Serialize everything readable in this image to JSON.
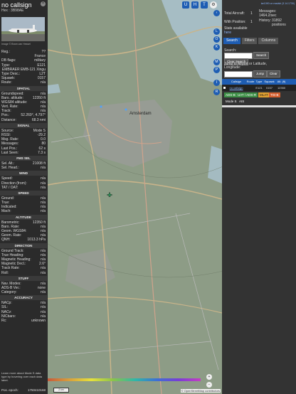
{
  "left": {
    "callsign": "no callsign",
    "hex_line": "Hex : 3B98AE",
    "photo_caption": "Image © Bram van Hessel",
    "info_rows": [
      {
        "k": "Reg.:",
        "v": "??"
      },
      {
        "k": "",
        "v": "France"
      },
      {
        "k": "DB flags:",
        "v": "military"
      },
      {
        "k": "Type:",
        "v": "E121"
      },
      {
        "k": "",
        "v": "EMBRAER EMB-121 Xingu"
      },
      {
        "k": "Type Desc.:",
        "v": "L2T"
      },
      {
        "k": "Squawk:",
        "v": "0157"
      },
      {
        "k": "Route:",
        "v": "n/a"
      }
    ],
    "sections": [
      {
        "title": "SPATIAL",
        "rows": [
          {
            "k": "Groundspeed:",
            "v": "n/a"
          },
          {
            "k": "Baro. altitude:",
            "v": "12350 ft"
          },
          {
            "k": "WGS84 altitude:",
            "v": "n/a"
          },
          {
            "k": "Vert. Rate:",
            "v": "n/a"
          },
          {
            "k": "Track:",
            "v": "n/a"
          },
          {
            "k": "Pos.:",
            "v": "52.269°, 4.797°"
          },
          {
            "k": "Distance:",
            "v": "68.3 nmi"
          }
        ]
      },
      {
        "title": "SIGNAL",
        "rows": [
          {
            "k": "Source:",
            "v": "Mode S"
          },
          {
            "k": "RSSI:",
            "v": "-29.2"
          },
          {
            "k": "Msg. Rate:",
            "v": "0.0"
          },
          {
            "k": "Messages:",
            "v": "80"
          },
          {
            "k": "Last Pos.:",
            "v": "62 s"
          },
          {
            "k": "Last Seen:",
            "v": "7.3 s"
          }
        ]
      },
      {
        "title": "FMS SEL",
        "rows": [
          {
            "k": "Sel. Alt.:",
            "v": "21008 ft"
          },
          {
            "k": "Sel. Head.:",
            "v": "n/a"
          }
        ]
      },
      {
        "title": "WIND",
        "rows": [
          {
            "k": "Speed:",
            "v": "n/a"
          },
          {
            "k": "Direction (from):",
            "v": "n/a"
          },
          {
            "k": "TAT / OAT:",
            "v": "n/a"
          }
        ]
      },
      {
        "title": "SPEED",
        "rows": [
          {
            "k": "Ground:",
            "v": "n/a"
          },
          {
            "k": "True:",
            "v": "n/a"
          },
          {
            "k": "Indicated:",
            "v": "n/a"
          },
          {
            "k": "Mach:",
            "v": "n/a"
          }
        ]
      },
      {
        "title": "ALTITUDE",
        "rows": [
          {
            "k": "Barometric:",
            "v": "12350 ft"
          },
          {
            "k": "Baro. Rate:",
            "v": "n/a"
          },
          {
            "k": "Geom. WGS84:",
            "v": "n/a"
          },
          {
            "k": "Geom. Rate:",
            "v": "n/a"
          },
          {
            "k": "QNH:",
            "v": "1013.3 hPa"
          }
        ]
      },
      {
        "title": "DIRECTION",
        "rows": [
          {
            "k": "Ground Track:",
            "v": "n/a"
          },
          {
            "k": "True Heading:",
            "v": "n/a"
          },
          {
            "k": "Magnetic Heading:",
            "v": "n/a"
          },
          {
            "k": "Magnetic Decl.:",
            "v": "2.6°"
          },
          {
            "k": "Track Rate:",
            "v": "n/a"
          },
          {
            "k": "Roll:",
            "v": "n/a"
          }
        ]
      },
      {
        "title": "STUFF",
        "rows": [
          {
            "k": "Nav. Modes:",
            "v": "n/a"
          },
          {
            "k": "ADS-B Ver.:",
            "v": "none"
          },
          {
            "k": "Category:",
            "v": "n/a"
          }
        ]
      },
      {
        "title": "ACCURACY",
        "rows": [
          {
            "k": "NACp:",
            "v": "n/a"
          },
          {
            "k": "SIL:",
            "v": "n/a"
          },
          {
            "k": "NACv:",
            "v": "n/a"
          },
          {
            "k": "NICbaro:",
            "v": "n/a"
          },
          {
            "k": "Rc:",
            "v": "unknown"
          }
        ]
      }
    ],
    "help_text": "Learn more about Mode S data type by hovering over each data label.",
    "epoch_label": "Pos. epoch:",
    "epoch_value": "1750410168"
  },
  "map": {
    "top_buttons": [
      "U",
      "H",
      "T"
    ],
    "side_buttons": [
      "L",
      "O",
      "K",
      "M",
      "P",
      "I",
      "R"
    ],
    "city_label": "Amsterdam",
    "zoom_in": "+",
    "zoom_out": "−",
    "scale_label": "2 km",
    "attribution": "© OpenStreetMap contributors"
  },
  "right": {
    "link": "tar1090 on readsb (3.14.1730)",
    "total_label": "Total Aircraft:",
    "total_value": "1",
    "withpos_label": "With Position:",
    "withpos_value": "1",
    "messages_label": "Messages:",
    "messages_value": "1464.2/sec",
    "history_label": "History:",
    "history_value": "31892 positions",
    "stats_label": "Stats available",
    "stats_link": "here",
    "tabs": [
      "Search",
      "Filters",
      "Columns"
    ],
    "search_label": "Search:",
    "search_button": "Search",
    "clear_search": "Clear Search",
    "jump_label": "Jump to Airport or Latitude, Longitude:",
    "jump_button": "Jump",
    "clear_button": "Clear",
    "table_headers": [
      "",
      "Callsign",
      "Route",
      "Type",
      "Squawk",
      "Alt. (ft)"
    ],
    "table_row": [
      "",
      "no callsign",
      "",
      "E121",
      "0157",
      "12350"
    ],
    "filters": [
      "ADS-B",
      "UAT / ADS-R",
      "MLAT",
      "TIS-B",
      "Mode S",
      "AIS"
    ]
  }
}
